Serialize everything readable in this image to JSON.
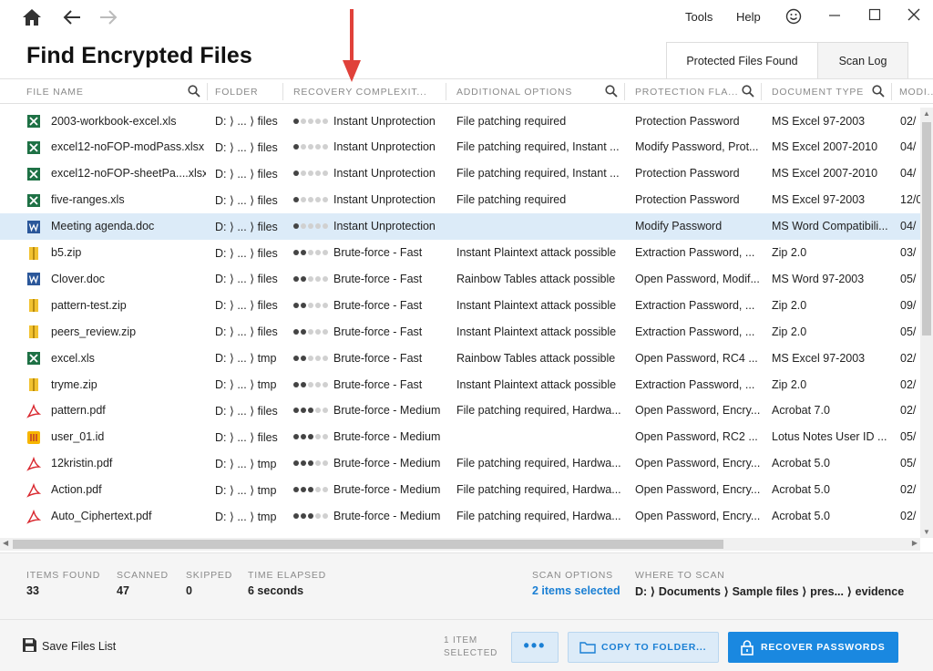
{
  "app": {
    "title": "Find Encrypted Files",
    "menu": {
      "tools": "Tools",
      "help": "Help"
    }
  },
  "tabs": [
    {
      "label": "Protected Files Found",
      "active": true
    },
    {
      "label": "Scan Log",
      "active": false
    }
  ],
  "columns": {
    "file_name": "FILE NAME",
    "folder": "FOLDER",
    "recovery": "RECOVERY COMPLEXIT...",
    "options": "ADDITIONAL OPTIONS",
    "protection": "PROTECTION FLA...",
    "doctype": "DOCUMENT TYPE",
    "modified": "MODI..."
  },
  "rows": [
    {
      "icon": "excel-icon",
      "name": "2003-workbook-excel.xls",
      "folder": "D: ⟩ ... ⟩ files",
      "level": 1,
      "recovery": "Instant Unprotection",
      "options": "File patching required",
      "protection": "Protection Password",
      "doctype": "MS Excel 97-2003",
      "modified": "02/"
    },
    {
      "icon": "excel-icon",
      "name": "excel12-noFOP-modPass.xlsx",
      "folder": "D: ⟩ ... ⟩ files",
      "level": 1,
      "recovery": "Instant Unprotection",
      "options": "File patching required, Instant ...",
      "protection": "Modify Password, Prot...",
      "doctype": "MS Excel 2007-2010",
      "modified": "04/"
    },
    {
      "icon": "excel-icon",
      "name": "excel12-noFOP-sheetPa....xlsx",
      "folder": "D: ⟩ ... ⟩ files",
      "level": 1,
      "recovery": "Instant Unprotection",
      "options": "File patching required, Instant ...",
      "protection": "Protection Password",
      "doctype": "MS Excel 2007-2010",
      "modified": "04/"
    },
    {
      "icon": "excel-icon",
      "name": "five-ranges.xls",
      "folder": "D: ⟩ ... ⟩ files",
      "level": 1,
      "recovery": "Instant Unprotection",
      "options": "File patching required",
      "protection": "Protection Password",
      "doctype": "MS Excel 97-2003",
      "modified": "12/0"
    },
    {
      "icon": "word-icon",
      "name": "Meeting agenda.doc",
      "folder": "D: ⟩ ... ⟩ files",
      "level": 1,
      "recovery": "Instant Unprotection",
      "options": "",
      "protection": "Modify Password",
      "doctype": "MS Word Compatibili...",
      "modified": "04/",
      "selected": true
    },
    {
      "icon": "zip-icon",
      "name": "b5.zip",
      "folder": "D: ⟩ ... ⟩ files",
      "level": 2,
      "recovery": "Brute-force - Fast",
      "options": "Instant Plaintext attack possible",
      "protection": "Extraction Password, ...",
      "doctype": "Zip 2.0",
      "modified": "03/"
    },
    {
      "icon": "word-icon",
      "name": "Clover.doc",
      "folder": "D: ⟩ ... ⟩ files",
      "level": 2,
      "recovery": "Brute-force - Fast",
      "options": "Rainbow Tables attack possible",
      "protection": "Open Password, Modif...",
      "doctype": "MS Word 97-2003",
      "modified": "05/"
    },
    {
      "icon": "zip-icon",
      "name": "pattern-test.zip",
      "folder": "D: ⟩ ... ⟩ files",
      "level": 2,
      "recovery": "Brute-force - Fast",
      "options": "Instant Plaintext attack possible",
      "protection": "Extraction Password, ...",
      "doctype": "Zip 2.0",
      "modified": "09/"
    },
    {
      "icon": "zip-icon",
      "name": "peers_review.zip",
      "folder": "D: ⟩ ... ⟩ files",
      "level": 2,
      "recovery": "Brute-force - Fast",
      "options": "Instant Plaintext attack possible",
      "protection": "Extraction Password, ...",
      "doctype": "Zip 2.0",
      "modified": "05/"
    },
    {
      "icon": "excel-icon",
      "name": "excel.xls",
      "folder": "D: ⟩ ... ⟩ tmp",
      "level": 2,
      "recovery": "Brute-force - Fast",
      "options": "Rainbow Tables attack possible",
      "protection": "Open Password, RC4 ...",
      "doctype": "MS Excel 97-2003",
      "modified": "02/"
    },
    {
      "icon": "zip-icon",
      "name": "tryme.zip",
      "folder": "D: ⟩ ... ⟩ tmp",
      "level": 2,
      "recovery": "Brute-force - Fast",
      "options": "Instant Plaintext attack possible",
      "protection": "Extraction Password, ...",
      "doctype": "Zip 2.0",
      "modified": "02/"
    },
    {
      "icon": "pdf-icon",
      "name": "pattern.pdf",
      "folder": "D: ⟩ ... ⟩ files",
      "level": 3,
      "recovery": "Brute-force - Medium",
      "options": "File patching required, Hardwa...",
      "protection": "Open Password, Encry...",
      "doctype": "Acrobat 7.0",
      "modified": "02/"
    },
    {
      "icon": "lotus-icon",
      "name": "user_01.id",
      "folder": "D: ⟩ ... ⟩ files",
      "level": 3,
      "recovery": "Brute-force - Medium",
      "options": "",
      "protection": "Open Password, RC2 ...",
      "doctype": "Lotus Notes User ID ...",
      "modified": "05/"
    },
    {
      "icon": "pdf-icon",
      "name": "12kristin.pdf",
      "folder": "D: ⟩ ... ⟩ tmp",
      "level": 3,
      "recovery": "Brute-force - Medium",
      "options": "File patching required, Hardwa...",
      "protection": "Open Password, Encry...",
      "doctype": "Acrobat 5.0",
      "modified": "05/"
    },
    {
      "icon": "pdf-icon",
      "name": "Action.pdf",
      "folder": "D: ⟩ ... ⟩ tmp",
      "level": 3,
      "recovery": "Brute-force - Medium",
      "options": "File patching required, Hardwa...",
      "protection": "Open Password, Encry...",
      "doctype": "Acrobat 5.0",
      "modified": "02/"
    },
    {
      "icon": "pdf-icon",
      "name": "Auto_Ciphertext.pdf",
      "folder": "D: ⟩ ... ⟩ tmp",
      "level": 3,
      "recovery": "Brute-force - Medium",
      "options": "File patching required, Hardwa...",
      "protection": "Open Password, Encry...",
      "doctype": "Acrobat 5.0",
      "modified": "02/"
    }
  ],
  "stats": {
    "items_found": {
      "label": "ITEMS FOUND",
      "value": "33"
    },
    "scanned": {
      "label": "SCANNED",
      "value": "47"
    },
    "skipped": {
      "label": "SKIPPED",
      "value": "0"
    },
    "time_elapsed": {
      "label": "TIME ELAPSED",
      "value": "6 seconds"
    },
    "scan_options": {
      "label": "SCAN OPTIONS",
      "value": "2 items selected"
    },
    "where_to_scan": {
      "label": "WHERE TO SCAN",
      "value": "D: ⟩ Documents ⟩ Sample files ⟩ pres... ⟩ evidence"
    }
  },
  "footer": {
    "save_label": "Save Files List",
    "selected_line1": "1 ITEM",
    "selected_line2": "SELECTED",
    "more_label": "•••",
    "copy_label": "COPY TO FOLDER...",
    "recover_label": "RECOVER PASSWORDS"
  },
  "colors": {
    "accent": "#1a88e0",
    "selected_row": "#dcebf8",
    "arrow": "#e0413a"
  }
}
